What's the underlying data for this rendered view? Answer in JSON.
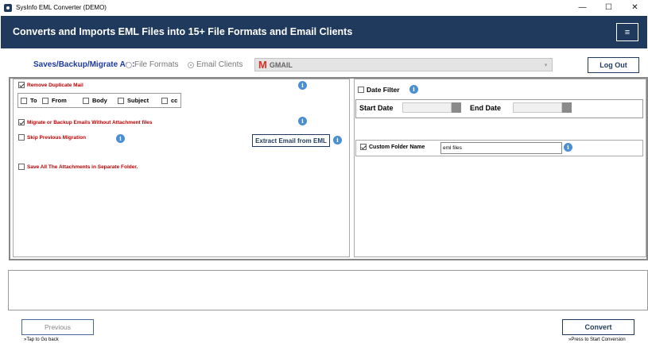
{
  "window": {
    "title": "SysInfo EML Converter (DEMO)",
    "minimize": "—",
    "maximize": "☐",
    "close": "✕"
  },
  "header": {
    "title": "Converts and Imports EML Files into 15+ File Formats and Email Clients",
    "menu_glyph": "≡"
  },
  "saves": {
    "label": "Saves/Backup/Migrate As :",
    "options": [
      "File Formats",
      "Email Clients"
    ],
    "selected": "Email Clients"
  },
  "combo": {
    "value": "GMAIL",
    "icon": "gmail-icon",
    "arrow": "▾"
  },
  "logout_label": "Log Out",
  "left": {
    "remove_duplicate": "Remove Duplicate Mail",
    "fields": [
      "To",
      "From",
      "Body",
      "Subject",
      "cc"
    ],
    "migrate_without_attachment": "Migrate or Backup Emails Without Attachment files",
    "skip_previous": "Skip Previous Migration",
    "extract_button": "Extract Email from EML",
    "save_attachments": "Save All The Attachments in Separate Folder."
  },
  "right": {
    "date_filter": "Date Filter",
    "start_date": "Start Date",
    "end_date": "End Date",
    "custom_folder_label": "Custom Folder Name",
    "custom_folder_value": "eml files"
  },
  "footer": {
    "previous_label": "Previous",
    "previous_hint": "»Tap to Go back",
    "convert_label": "Convert",
    "convert_hint": "»Press to Start Conversion"
  },
  "info_glyph": "i",
  "colors": {
    "header_bg": "#1f3a5c",
    "accent_red": "#c00000",
    "label_blue": "#1c3aa0",
    "info_blue": "#4a8fd4"
  }
}
